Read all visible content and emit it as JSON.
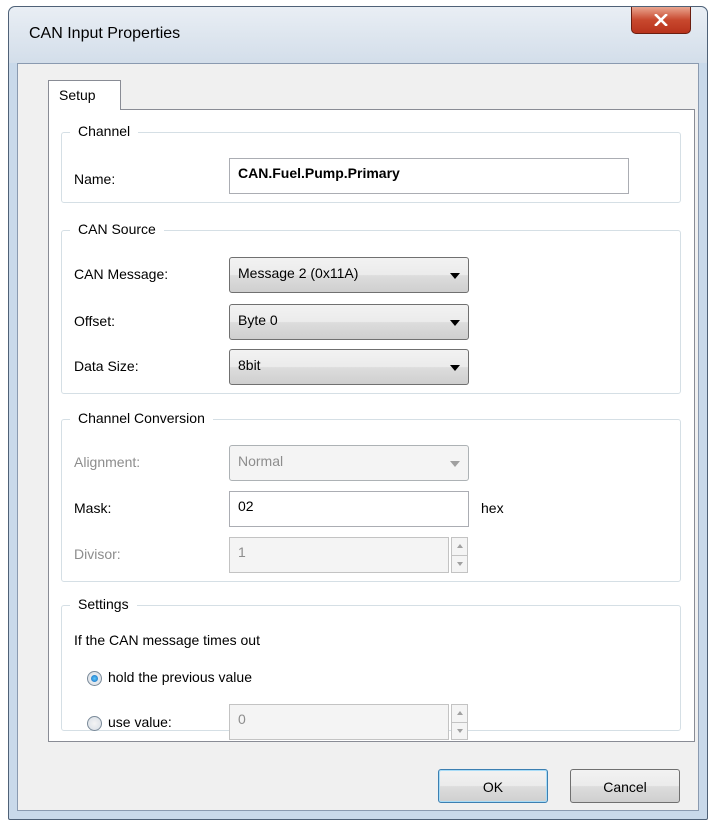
{
  "window": {
    "title": "CAN Input Properties"
  },
  "tabs": [
    {
      "label": "Setup"
    }
  ],
  "channel": {
    "legend": "Channel",
    "name_label": "Name:",
    "name_value": "CAN.Fuel.Pump.Primary"
  },
  "can_source": {
    "legend": "CAN Source",
    "message_label": "CAN Message:",
    "message_value": "Message 2 (0x11A)",
    "offset_label": "Offset:",
    "offset_value": "Byte 0",
    "datasize_label": "Data Size:",
    "datasize_value": "8bit"
  },
  "conversion": {
    "legend": "Channel Conversion",
    "alignment_label": "Alignment:",
    "alignment_value": "Normal",
    "mask_label": "Mask:",
    "mask_value": "02",
    "mask_unit": "hex",
    "divisor_label": "Divisor:",
    "divisor_value": "1"
  },
  "settings": {
    "legend": "Settings",
    "description": "If the CAN message times out",
    "option_hold": "hold the previous value",
    "option_use": "use value:",
    "use_value": "0",
    "selected": "hold"
  },
  "buttons": {
    "ok": "OK",
    "cancel": "Cancel"
  }
}
